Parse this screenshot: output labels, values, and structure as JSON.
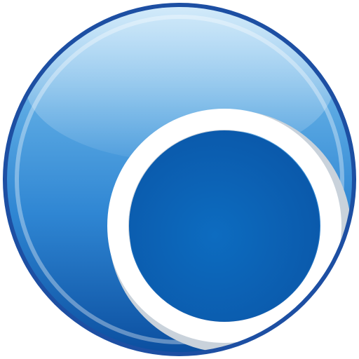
{
  "icon": {
    "name": "blue-circle-ring-logo-icon",
    "colors": {
      "outer_rim": "#1d4fa3",
      "glossy_top": "#8fc7ef",
      "body_mid": "#2f86d3",
      "body_deep": "#0b5cae",
      "inner_disc": "#0a63b5",
      "ring": "#ffffff",
      "ring_shadow": "#cfd7df"
    }
  }
}
